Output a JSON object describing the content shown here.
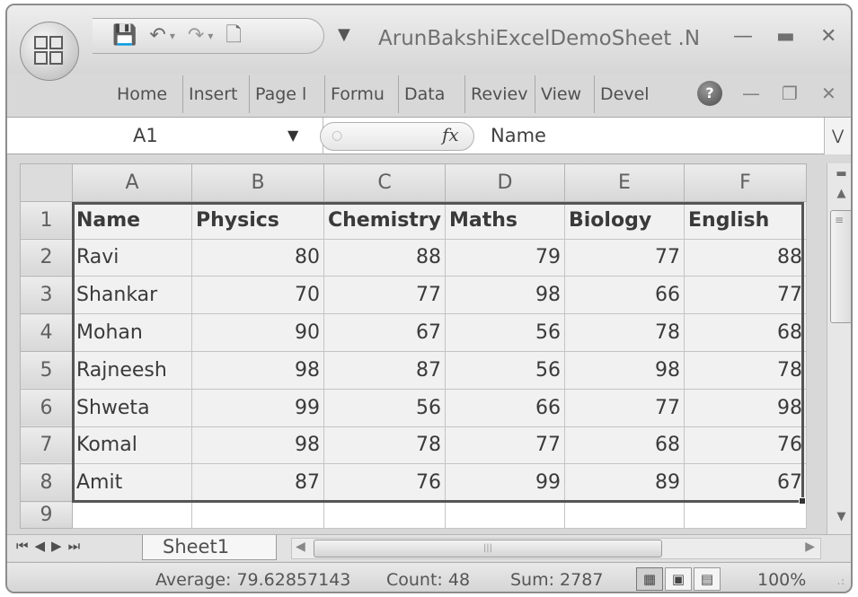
{
  "window": {
    "title": "ArunBakshiExcelDemoSheet .N",
    "controls": [
      "minimize-icon",
      "maximize-icon",
      "close-icon"
    ]
  },
  "quick_access": {
    "icons": [
      "office-button-icon",
      "save-icon",
      "undo-icon",
      "redo-icon",
      "new-document-icon",
      "customize-dropdown-icon"
    ]
  },
  "ribbon": {
    "tabs": [
      "Home",
      "Insert",
      "Page l",
      "Formu",
      "Data",
      "Reviev",
      "View",
      "Devel"
    ]
  },
  "formula_bar": {
    "name_box": "A1",
    "formula": "Name"
  },
  "sheet": {
    "column_headers": [
      "A",
      "B",
      "C",
      "D",
      "E",
      "F"
    ],
    "row_headers": [
      "1",
      "2",
      "3",
      "4",
      "5",
      "6",
      "7",
      "8",
      "9"
    ],
    "header_row": [
      "Name",
      "Physics",
      "Chemistry",
      "Maths",
      "Biology",
      "English"
    ],
    "rows": [
      [
        "Ravi",
        "80",
        "88",
        "79",
        "77",
        "88"
      ],
      [
        "Shankar",
        "70",
        "77",
        "98",
        "66",
        "77"
      ],
      [
        "Mohan",
        "90",
        "67",
        "56",
        "78",
        "68"
      ],
      [
        "Rajneesh",
        "98",
        "87",
        "56",
        "98",
        "78"
      ],
      [
        "Shweta",
        "99",
        "56",
        "66",
        "77",
        "98"
      ],
      [
        "Komal",
        "98",
        "78",
        "77",
        "68",
        "76"
      ],
      [
        "Amit",
        "87",
        "76",
        "99",
        "89",
        "67"
      ]
    ],
    "selection": "A1:F8"
  },
  "sheet_tabs": {
    "tabs": [
      "Sheet1"
    ],
    "active": "Sheet1"
  },
  "status_bar": {
    "average": "Average: 79.62857143",
    "count": "Count: 48",
    "sum": "Sum: 2787",
    "zoom": "100%",
    "active_view": "normal"
  }
}
